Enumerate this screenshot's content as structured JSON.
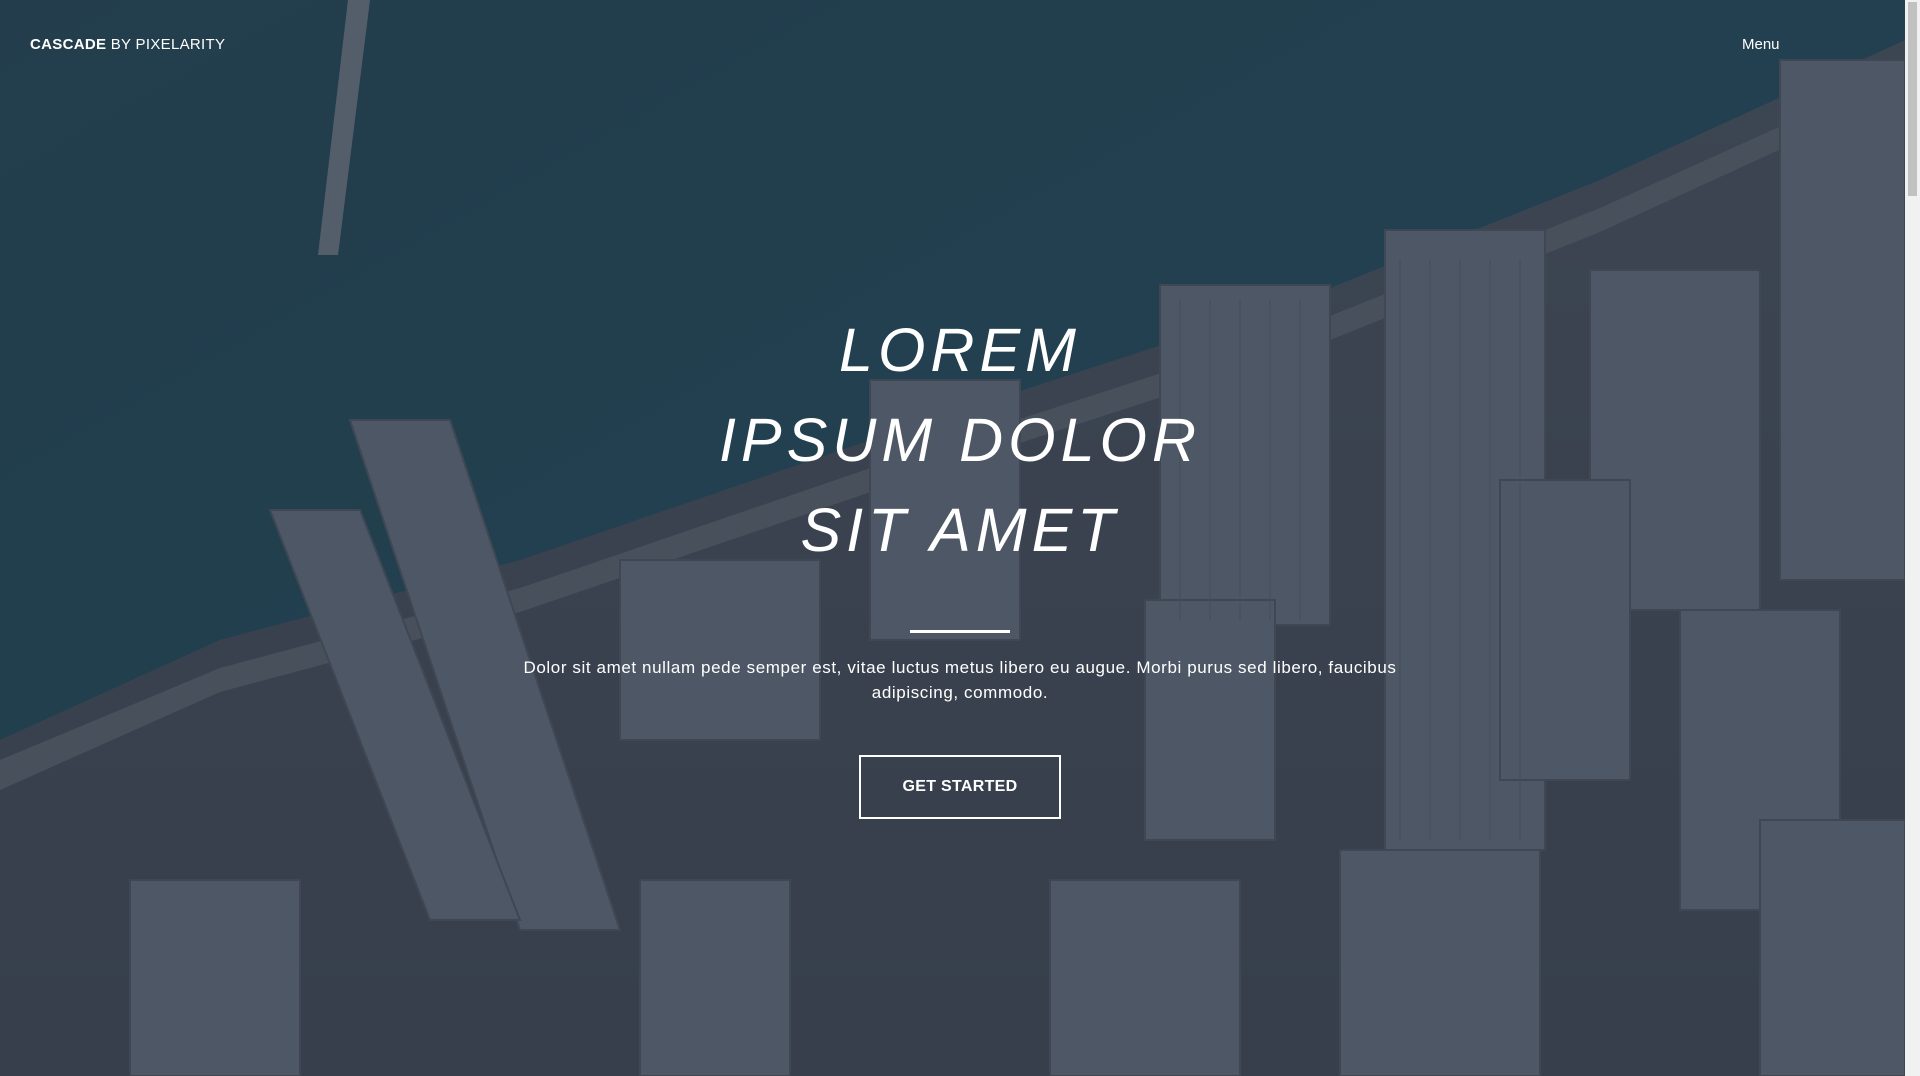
{
  "header": {
    "brand": "CASCADE",
    "byline": "BY PIXELARITY",
    "menu_label": "Menu"
  },
  "hero": {
    "title_lines": [
      "LOREM",
      "IPSUM DOLOR",
      "SIT AMET"
    ],
    "subtitle": "Dolor sit amet nullam pede semper est, vitae luctus metus libero eu augue. Morbi purus sed libero, faucibus adipiscing, commodo.",
    "cta_label": "GET STARTED",
    "background_image": "aerial-city-skyline"
  },
  "colors": {
    "text": "#ffffff",
    "overlay": "#28303e",
    "water": "#1f4552"
  }
}
